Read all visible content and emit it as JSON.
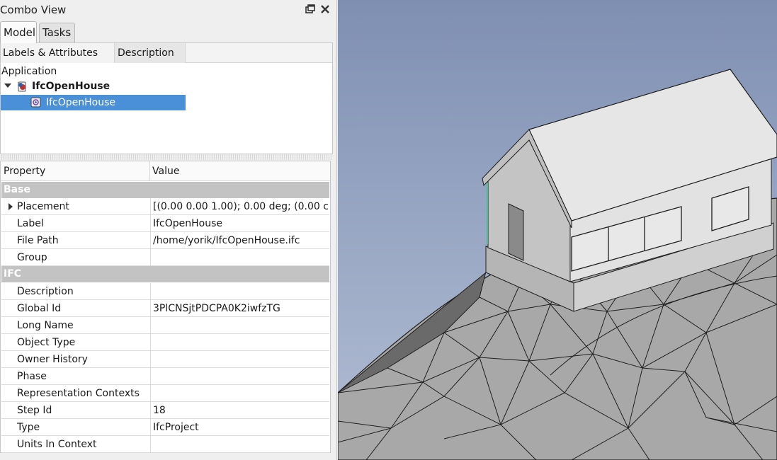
{
  "window": {
    "title": "Combo View"
  },
  "tabs": [
    {
      "label": "Model",
      "active": true
    },
    {
      "label": "Tasks",
      "active": false
    }
  ],
  "tree": {
    "columns": [
      "Labels & Attributes",
      "Description"
    ],
    "root_label": "Application",
    "document_label": "IfcOpenHouse",
    "object_label": "IfcOpenHouse"
  },
  "properties": {
    "header_property": "Property",
    "header_value": "Value",
    "groups": [
      {
        "name": "Base",
        "rows": [
          {
            "name": "Placement",
            "value": "[(0.00 0.00 1.00); 0.00 deg; (0.00 c...",
            "expandable": true
          },
          {
            "name": "Label",
            "value": "IfcOpenHouse"
          },
          {
            "name": "File Path",
            "value": "/home/yorik/IfcOpenHouse.ifc"
          },
          {
            "name": "Group",
            "value": ""
          }
        ]
      },
      {
        "name": "IFC",
        "rows": [
          {
            "name": "Description",
            "value": ""
          },
          {
            "name": "Global Id",
            "value": "3PlCNSjtPDCPA0K2iwfzTG"
          },
          {
            "name": "Long Name",
            "value": ""
          },
          {
            "name": "Object Type",
            "value": ""
          },
          {
            "name": "Owner History",
            "value": ""
          },
          {
            "name": "Phase",
            "value": ""
          },
          {
            "name": "Representation Contexts",
            "value": ""
          },
          {
            "name": "Step Id",
            "value": "18"
          },
          {
            "name": "Type",
            "value": "IfcProject"
          },
          {
            "name": "Units In Context",
            "value": ""
          }
        ]
      }
    ]
  },
  "colors": {
    "selection": "#4a90d9",
    "group_header": "#c3c3c3",
    "viewport_top": "#7f8fb2",
    "viewport_bottom": "#b2bdd3"
  },
  "icons": {
    "float": "float-window-icon",
    "close": "close-icon",
    "document": "freecad-document-icon",
    "object": "ifc-project-icon"
  }
}
